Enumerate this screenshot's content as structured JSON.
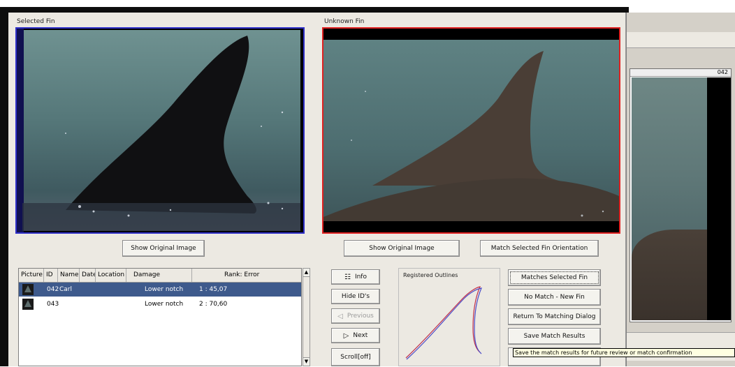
{
  "selected_panel": {
    "title": "Selected Fin",
    "show_original_label": "Show Original Image"
  },
  "unknown_panel": {
    "title": "Unknown Fin",
    "show_original_label": "Show Original Image",
    "match_orientation_label": "Match Selected Fin Orientation"
  },
  "background_window": {
    "id_label": "042"
  },
  "table": {
    "columns": [
      "Picture",
      "ID",
      "Name",
      "Date",
      "Location",
      "Damage",
      "Rank: Error"
    ],
    "rows": [
      {
        "id": "042",
        "name": "Carl",
        "date": "",
        "location": "",
        "damage": "Lower notch",
        "rank": "1 : 45,07",
        "selected": true
      },
      {
        "id": "043",
        "name": "",
        "date": "",
        "location": "",
        "damage": "Lower notch",
        "rank": "2 : 70,60",
        "selected": false
      }
    ]
  },
  "nav_buttons": {
    "info": "Info",
    "hide_ids": "Hide ID's",
    "previous": "Previous",
    "next": "Next",
    "scroll_off": "Scroll[off]"
  },
  "registered_outlines": {
    "title": "Registered Outlines"
  },
  "action_buttons": {
    "matches_selected": "Matches Selected Fin",
    "no_match": "No Match - New Fin",
    "return_dialog": "Return To Matching Dialog",
    "save_results": "Save Match Results"
  },
  "tooltip": "Save the match results for future review or match confirmation",
  "colors": {
    "selected_border": "#2f2fc8",
    "unknown_border": "#e02020",
    "selection_row": "#3e5a8c",
    "outline_red": "#c0304a",
    "outline_blue": "#4a4ac8"
  },
  "icons": {
    "info": "info-icon",
    "previous": "left-triangle-icon",
    "next": "right-triangle-icon"
  }
}
